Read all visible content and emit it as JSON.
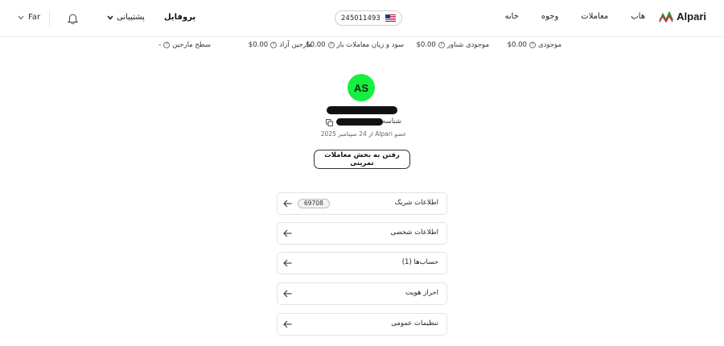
{
  "header": {
    "logo_text": "Alpari",
    "nav": [
      "خانه",
      "وجوه",
      "معاملات",
      "هاب"
    ],
    "account_number": "245011493",
    "profile_label": "پروفایل",
    "support_label": "پشتیبانی",
    "language": "Far"
  },
  "stats": [
    {
      "label": "موجودی",
      "value": "$0.00"
    },
    {
      "label": "موجودی شناور",
      "value": "$0.00"
    },
    {
      "label": "سود و زیان معاملات باز",
      "value": "$0.00"
    },
    {
      "label": "مارجین آزاد",
      "value": "$0.00"
    },
    {
      "label": "سطح مارجین",
      "value": "-"
    }
  ],
  "profile": {
    "initials": "AS",
    "avatar_color": "#16ee41",
    "id_label": "شناسه",
    "member_since": "عضو Alpari از 24 سپتامبر 2025",
    "demo_button": "رفتن به بخش معاملات تمرینی"
  },
  "menu": [
    {
      "label": "اطلاعات شریک",
      "badge": "69708"
    },
    {
      "label": "اطلاعات شخصی"
    },
    {
      "label": "حساب‌ها (1)"
    },
    {
      "label": "احراز هویت"
    },
    {
      "label": "تنظیمات عمومی"
    }
  ]
}
